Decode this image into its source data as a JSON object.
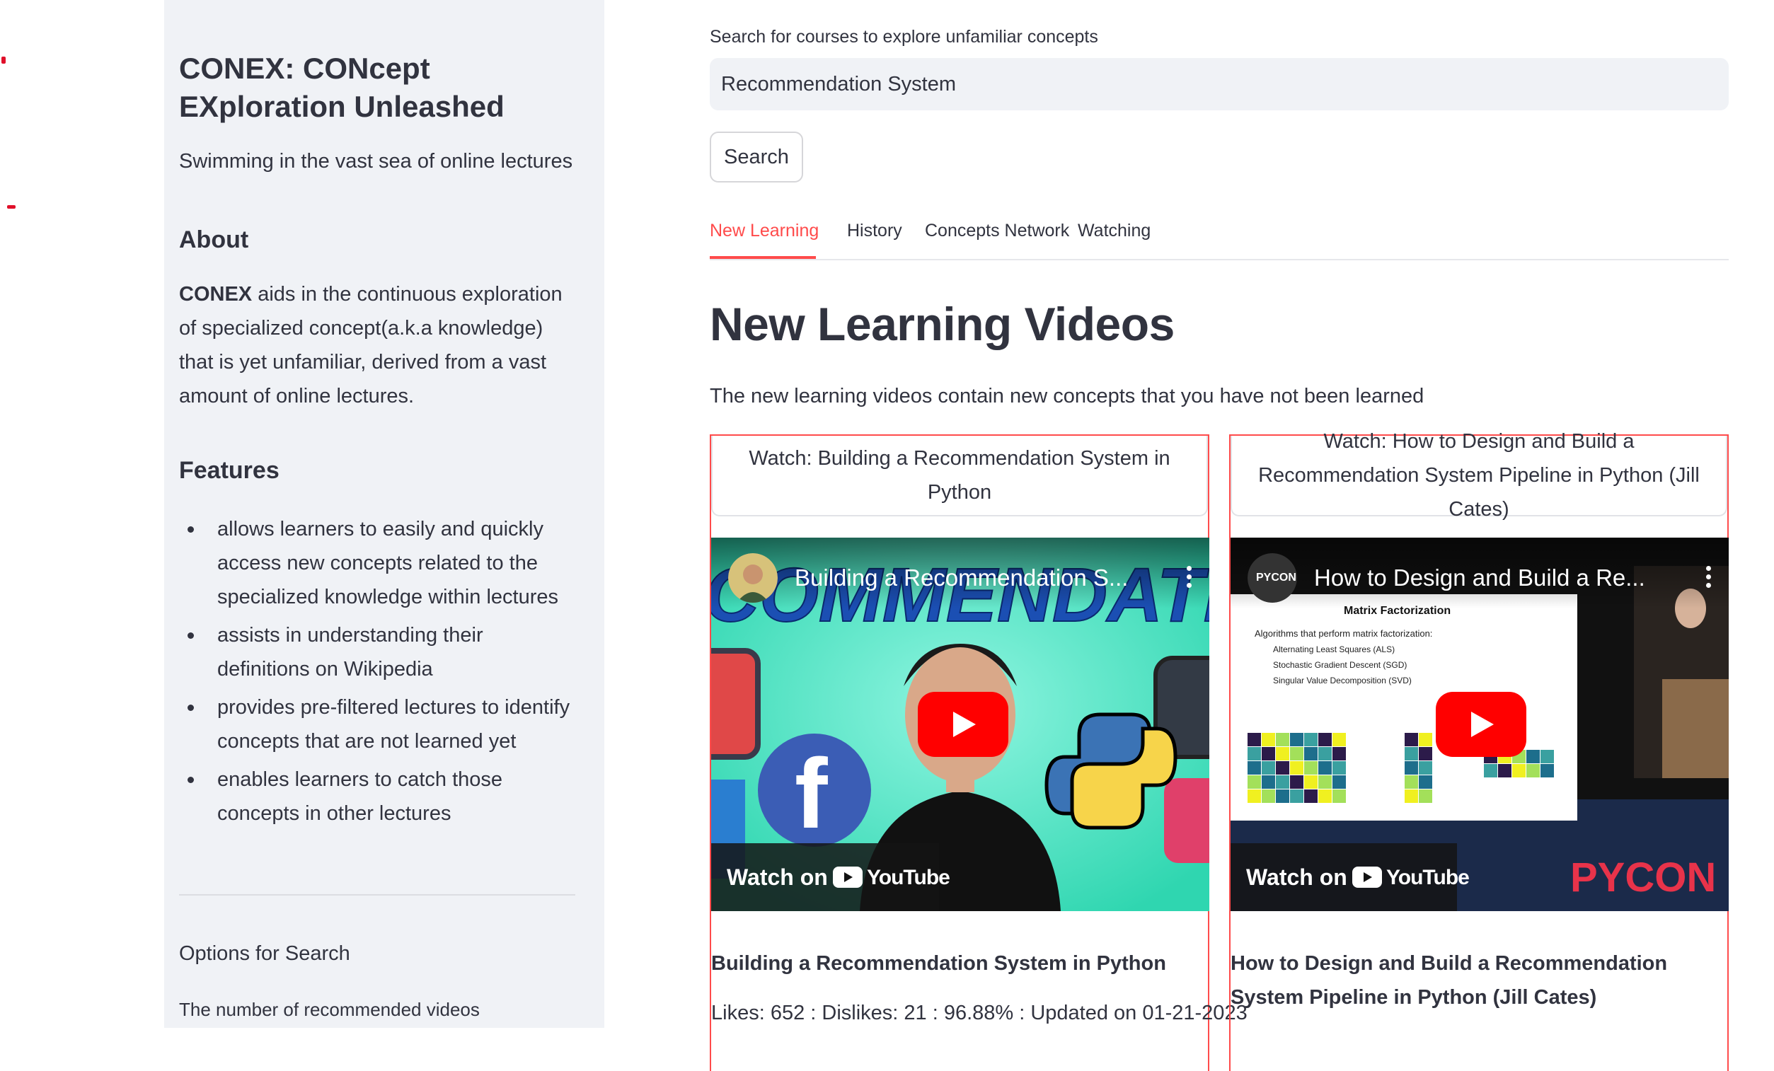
{
  "sidebar": {
    "title": "CONEX: CONcept EXploration Unleashed",
    "subtitle": "Swimming in the vast sea of online lectures",
    "about_heading": "About",
    "about_bold": "CONEX",
    "about_text": " aids in the continuous exploration of specialized concept(a.k.a knowledge) that is yet unfamiliar, derived from a vast amount of online lectures.",
    "features_heading": "Features",
    "features": [
      "allows learners to easily and quickly access new concepts related to the specialized knowledge within lectures",
      "assists in understanding their definitions on Wikipedia",
      "provides pre-filtered lectures to identify concepts that are not learned yet",
      "enables learners to catch those concepts in other lectures"
    ],
    "options_label": "Options for Search",
    "num_videos_label": "The number of recommended videos"
  },
  "search": {
    "label": "Search for courses to explore unfamiliar concepts",
    "value": "Recommendation System",
    "button": "Search"
  },
  "tabs": [
    {
      "label": "New Learning",
      "active": true
    },
    {
      "label": "History",
      "active": false
    },
    {
      "label": "Concepts Network",
      "active": false
    },
    {
      "label": "Watching",
      "active": false
    }
  ],
  "main": {
    "heading": "New Learning Videos",
    "description": "The new learning videos contain new concepts that you have not been learned"
  },
  "cards": [
    {
      "watch_button": "Watch: Building a Recommendation System in Python",
      "video_title": "Building a Recommendation S...",
      "watch_on": "Watch on",
      "youtube": "YouTube",
      "title": "Building a Recommendation System in Python",
      "meta": "Likes: 652 : Dislikes: 21 : 96.88% : Updated on 01-21-2023"
    },
    {
      "watch_button": "Watch: How to Design and Build a Recommendation System Pipeline in Python (Jill Cates)",
      "video_title": "How to Design and Build a Re...",
      "channel_badge": "PYCON",
      "watch_on": "Watch on",
      "youtube": "YouTube",
      "slide_title": "Matrix Factorization",
      "slide_bullets": [
        "Algorithms that perform matrix factorization:",
        "Alternating Least Squares (ALS)",
        "Stochastic Gradient Descent (SGD)",
        "Singular Value Decomposition (SVD)"
      ],
      "title": "How to Design and Build a Recommendation System Pipeline in Python (Jill Cates)"
    }
  ],
  "colors": {
    "accent": "#ff4b4b",
    "sidebar_bg": "#f0f2f6",
    "text": "#31333f"
  }
}
